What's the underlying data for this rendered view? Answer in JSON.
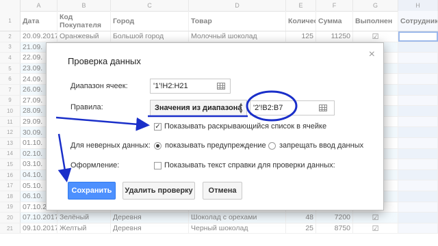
{
  "columns": {
    "letters": [
      "A",
      "B",
      "C",
      "D",
      "E",
      "F",
      "G",
      "H"
    ],
    "headers": [
      "Дата",
      "Код Покупателя",
      "Город",
      "Товар",
      "Количество",
      "Сумма",
      "Выполнен",
      "Сотрудник"
    ]
  },
  "rows": [
    {
      "num": "2",
      "cells": [
        "20.09.2017",
        "Оранжевый",
        "Большой город",
        "Молочный шоколад",
        "125",
        "11250",
        "☑",
        ""
      ]
    },
    {
      "num": "3",
      "cells": [
        "21.09.",
        "",
        "",
        "",
        "",
        "",
        "☑",
        ""
      ]
    },
    {
      "num": "4",
      "cells": [
        "22.09.",
        "",
        "",
        "",
        "",
        "",
        "☑",
        ""
      ]
    },
    {
      "num": "5",
      "cells": [
        "23.09.",
        "",
        "",
        "",
        "",
        "",
        "☑",
        ""
      ]
    },
    {
      "num": "6",
      "cells": [
        "24.09.",
        "",
        "",
        "",
        "",
        "",
        "☑",
        ""
      ]
    },
    {
      "num": "7",
      "cells": [
        "26.09.",
        "",
        "",
        "",
        "",
        "",
        "☑",
        ""
      ]
    },
    {
      "num": "9",
      "cells": [
        "27.09.",
        "",
        "",
        "",
        "",
        "",
        "☑",
        ""
      ]
    },
    {
      "num": "10",
      "cells": [
        "28.09.",
        "",
        "",
        "",
        "",
        "",
        "☑",
        ""
      ]
    },
    {
      "num": "11",
      "cells": [
        "29.09.",
        "",
        "",
        "",
        "",
        "",
        "☑",
        ""
      ]
    },
    {
      "num": "12",
      "cells": [
        "30.09.",
        "",
        "",
        "",
        "",
        "",
        "☑",
        ""
      ]
    },
    {
      "num": "13",
      "cells": [
        "01.10.",
        "",
        "",
        "",
        "",
        "",
        "☑",
        ""
      ]
    },
    {
      "num": "14",
      "cells": [
        "02.10.",
        "",
        "",
        "",
        "",
        "",
        "☑",
        ""
      ]
    },
    {
      "num": "15",
      "cells": [
        "03.10.",
        "",
        "",
        "",
        "",
        "",
        "☑",
        ""
      ]
    },
    {
      "num": "16",
      "cells": [
        "04.10.",
        "",
        "",
        "",
        "",
        "",
        "☑",
        ""
      ]
    },
    {
      "num": "17",
      "cells": [
        "05.10.",
        "",
        "",
        "",
        "",
        "",
        "☑",
        ""
      ]
    },
    {
      "num": "18",
      "cells": [
        "06.10.",
        "",
        "",
        "",
        "",
        "",
        "☑",
        ""
      ]
    },
    {
      "num": "19",
      "cells": [
        "07.10.2017",
        "Белый",
        "Деревня",
        "Молочный шоколад",
        "25",
        "2250",
        "☑",
        ""
      ]
    },
    {
      "num": "20",
      "cells": [
        "07.10.2017",
        "Зелёный",
        "Деревня",
        "Шоколад с орехами",
        "48",
        "7200",
        "☑",
        ""
      ]
    },
    {
      "num": "21",
      "cells": [
        "09.10.2017",
        "Желтый",
        "Деревня",
        "Черный шоколад",
        "25",
        "8750",
        "☑",
        ""
      ]
    }
  ],
  "dialog": {
    "title": "Проверка данных",
    "close_icon": "×",
    "range_label": "Диапазон ячеек:",
    "range_value": "'1'!H2:H21",
    "rules_label": "Правила:",
    "rule_type": "Значения из диапазона",
    "rule_range": "'2'!B2:B7",
    "show_dropdown_label": "Показывать раскрывающийся список в ячейке",
    "show_dropdown_checked": "✓",
    "invalid_label": "Для неверных данных:",
    "invalid_warn": "показывать предупреждение",
    "invalid_reject": "запрещать ввод данных",
    "appearance_label": "Оформление:",
    "help_text_label": "Показывать текст справки для проверки данных:",
    "save_button": "Сохранить",
    "remove_button": "Удалить проверку",
    "cancel_button": "Отмена"
  },
  "colors": {
    "primary_button": "#4d90fe",
    "annotation_blue": "#1a2fc9",
    "row_alt": "#e8f4fb"
  }
}
